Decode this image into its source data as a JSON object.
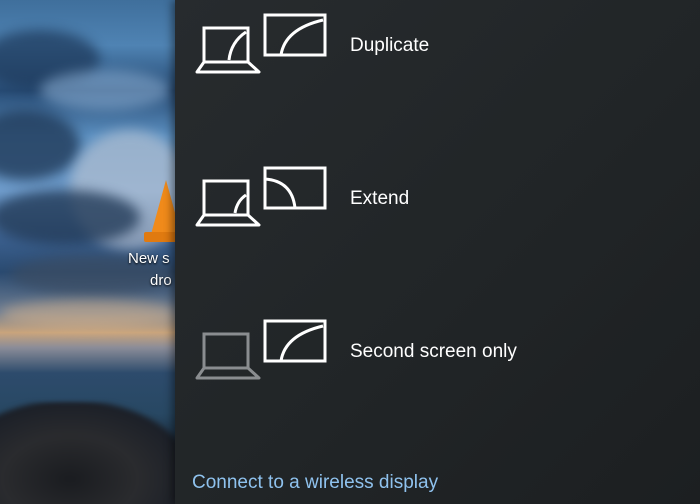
{
  "desktop": {
    "icon_label_line1": "New s",
    "icon_label_line2": "dro",
    "icon_name": "vlc-icon"
  },
  "project_pane": {
    "options": [
      {
        "label": "Duplicate",
        "icon": "duplicate-display-icon"
      },
      {
        "label": "Extend",
        "icon": "extend-display-icon"
      },
      {
        "label": "Second screen only",
        "icon": "second-screen-only-icon"
      }
    ],
    "wireless_link": "Connect to a wireless display",
    "colors": {
      "pane_background": "#222628",
      "text": "#ffffff",
      "link": "#8fc2ee",
      "icon_active": "#ffffff",
      "icon_inactive": "#8a8d90"
    }
  }
}
